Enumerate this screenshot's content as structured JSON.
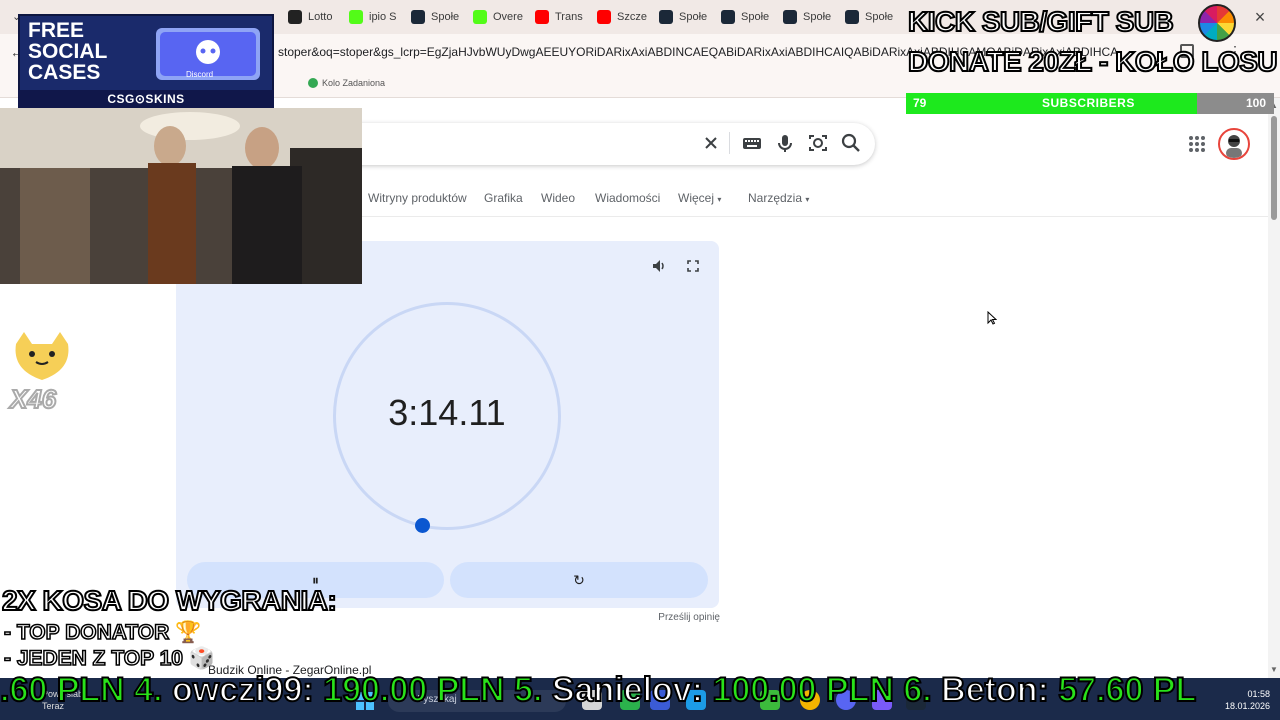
{
  "browser": {
    "tabs": [
      {
        "label": "Lotto",
        "color": "#222222"
      },
      {
        "label": "ipio S",
        "color": "#53fc18"
      },
      {
        "label": "Społe",
        "color": "#1b2838"
      },
      {
        "label": "Overe",
        "color": "#53fc18"
      },
      {
        "label": "Trans",
        "color": "#ff0000"
      },
      {
        "label": "Szcze",
        "color": "#ff0000"
      },
      {
        "label": "Społe",
        "color": "#1b2838"
      },
      {
        "label": "Społe",
        "color": "#1b2838"
      },
      {
        "label": "Społe",
        "color": "#1b2838"
      },
      {
        "label": "Społe",
        "color": "#1b2838"
      }
    ],
    "url": "stoper&oq=stoper&gs_lcrp=EgZjaHJvbWUyDwgAEEUYORiDARixAxiABDINCAEQABiDARixAxiABDIHCAIQABiDARixAxiABDIHCAMQABiDARixAxiABDIHCAQAB",
    "bookmark": "Kolo Zadaniona"
  },
  "search": {
    "nav": [
      "Witryny produktów",
      "Grafika",
      "Wideo",
      "Wiadomości",
      "Więcej",
      "Narzędzia"
    ]
  },
  "stopwatch": {
    "time": "3:14.11",
    "pause_glyph": "⏸",
    "reset_glyph": "↻",
    "feedback": "Prześlij opinię"
  },
  "result": {
    "title": "Budzik Online - ZegarOnline.pl"
  },
  "overlays": {
    "sponsor_line1": "FREE",
    "sponsor_line2": "SOCIAL",
    "sponsor_line3": "CASES",
    "sponsor_brand": "CSG⊙SKINS",
    "sponsor_discord": "Discord",
    "cat_count": "X46",
    "kick_line1": "KICK SUB/GIFT SUB",
    "kick_line2": "DONATE 20ZŁ - KOŁO LOSU",
    "subs_current": "79",
    "subs_label": "SUBSCRIBERS",
    "subs_goal": "100",
    "subs_progress": 0.79,
    "promo_line1": "2X KOSA DO WYGRANIA:",
    "promo_line2": "- TOP DONATOR 🏆",
    "promo_line3": "- JEDEN Z TOP 10 🎲"
  },
  "ticker": [
    {
      "text": ".60 PLN ",
      "c": "g"
    },
    {
      "text": "4. ",
      "c": "g"
    },
    {
      "text": "owczi99: ",
      "c": "w"
    },
    {
      "text": "190.00 PLN ",
      "c": "g"
    },
    {
      "text": "5. ",
      "c": "g"
    },
    {
      "text": "Sanielov: ",
      "c": "w"
    },
    {
      "text": "100.00 PLN ",
      "c": "g"
    },
    {
      "text": "6. ",
      "c": "g"
    },
    {
      "text": "Beton: ",
      "c": "w"
    },
    {
      "text": "57.60 PL",
      "c": "g"
    }
  ],
  "taskbar": {
    "weather_line1": "Pow.: slab",
    "weather_line2": "Teraz",
    "search_placeholder": "Wyszukaj",
    "time": "01:58",
    "date": "18.01.2026"
  },
  "colors": {
    "accent": "#0b57d0",
    "card": "#e8eefc",
    "button": "#d3e2fd",
    "subs_bar": "#1de91d",
    "ticker_green": "#29e21a"
  }
}
